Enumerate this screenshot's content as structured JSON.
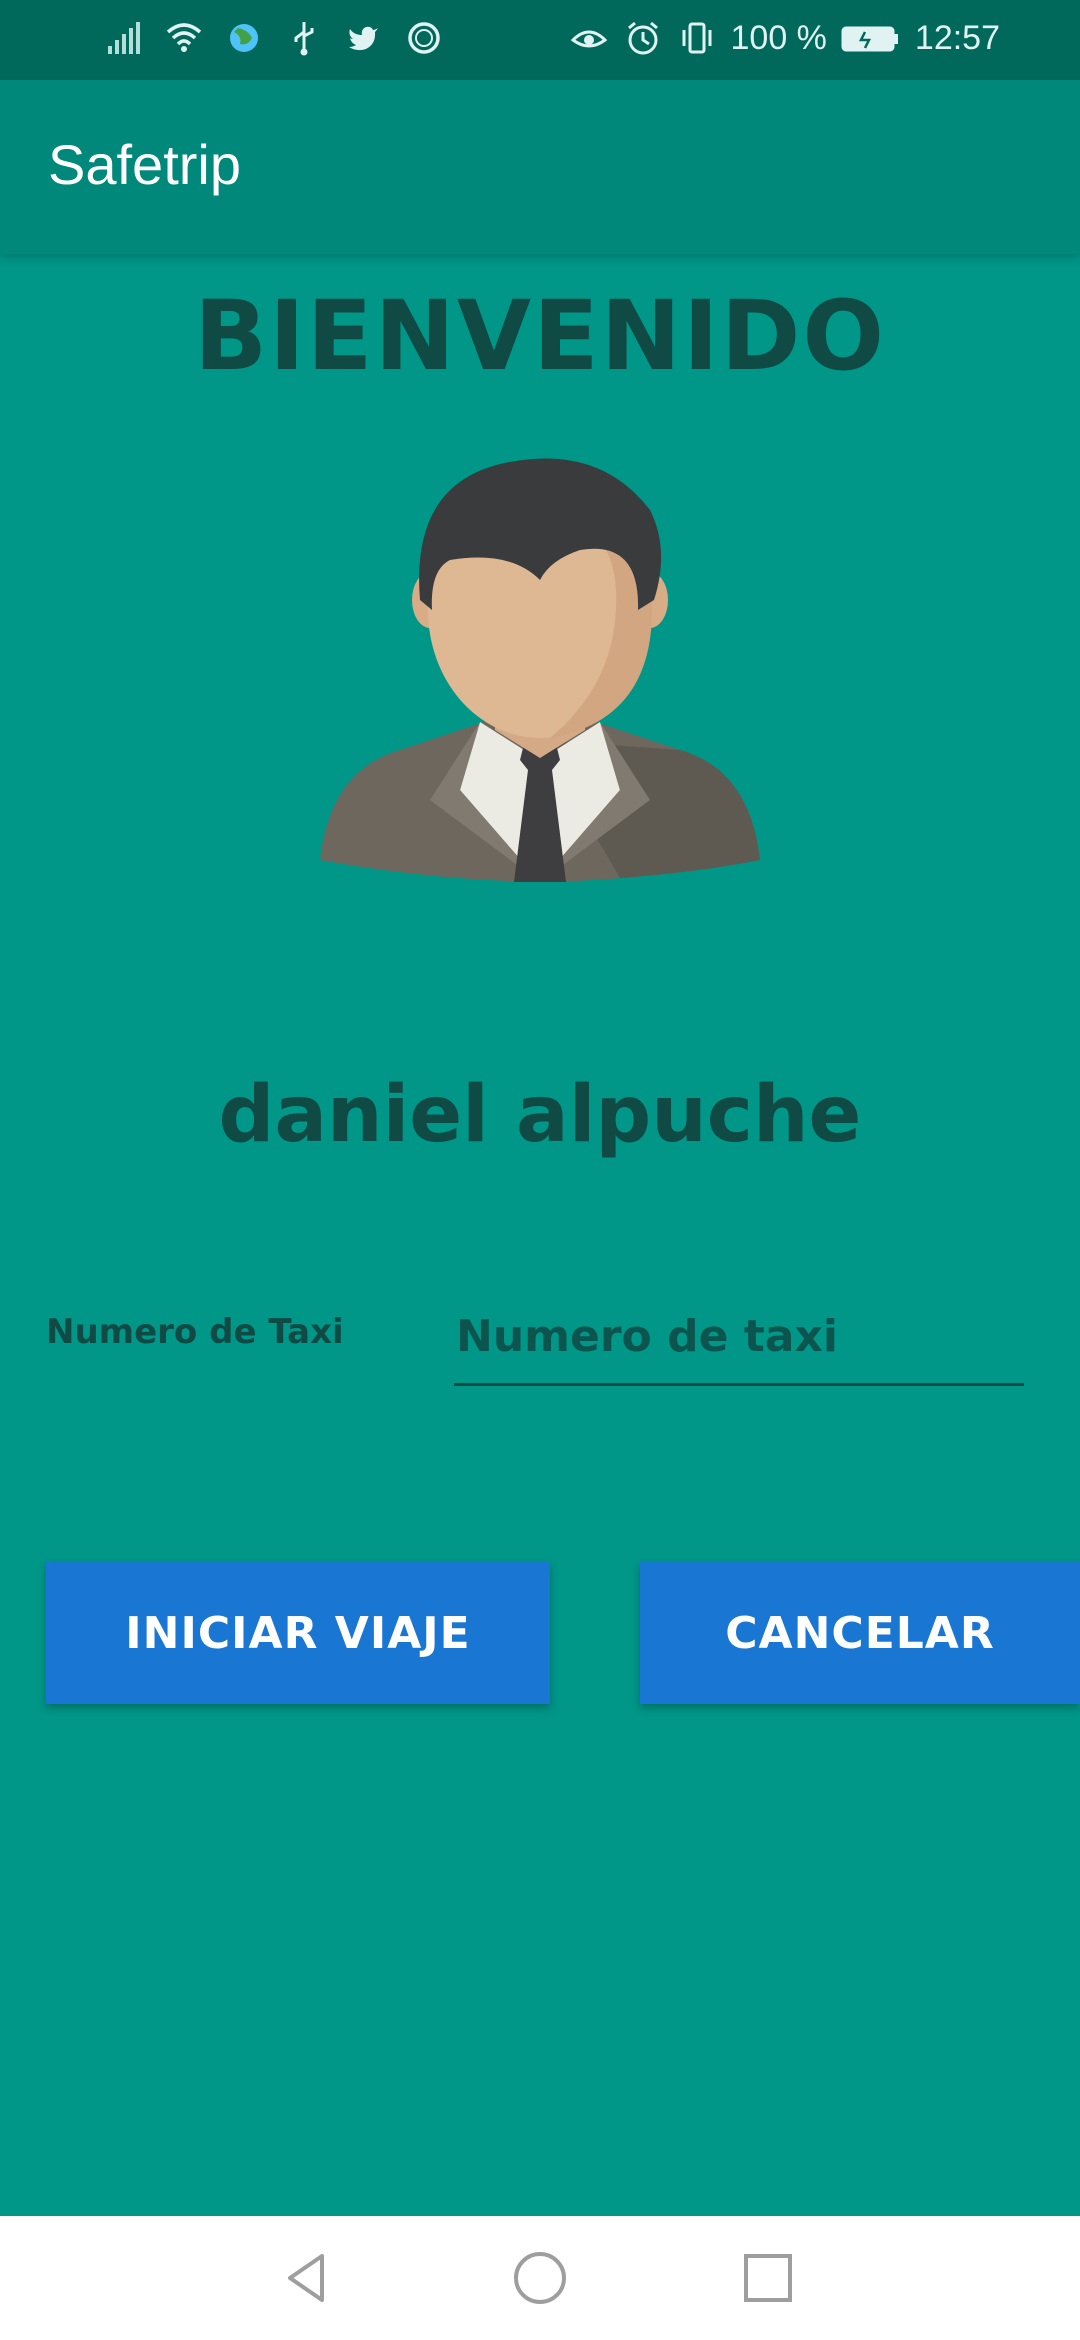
{
  "status_bar": {
    "battery": "100 %",
    "time": "12:57",
    "icons_left": [
      "signal-icon",
      "wifi-icon",
      "globe-icon",
      "usb-icon",
      "twitter-icon",
      "sync-icon"
    ],
    "icons_right": [
      "eye-icon",
      "alarm-icon",
      "vibrate-icon",
      "battery-icon"
    ]
  },
  "app_bar": {
    "title": "Safetrip"
  },
  "main": {
    "welcome": "BIENVENIDO",
    "user_name": "daniel alpuche",
    "taxi_label": "Numero de Taxi",
    "taxi_input": {
      "value": "",
      "placeholder": "Numero de taxi"
    },
    "start_button": "INICIAR VIAJE",
    "cancel_button": "CANCELAR"
  },
  "nav_bar": {
    "items": [
      "back-icon",
      "home-icon",
      "recents-icon"
    ]
  },
  "colors": {
    "background": "#009688",
    "app_bar": "#00897B",
    "status_bar": "#00695C",
    "dark_text": "#0F4A44",
    "button": "#1976D2"
  }
}
